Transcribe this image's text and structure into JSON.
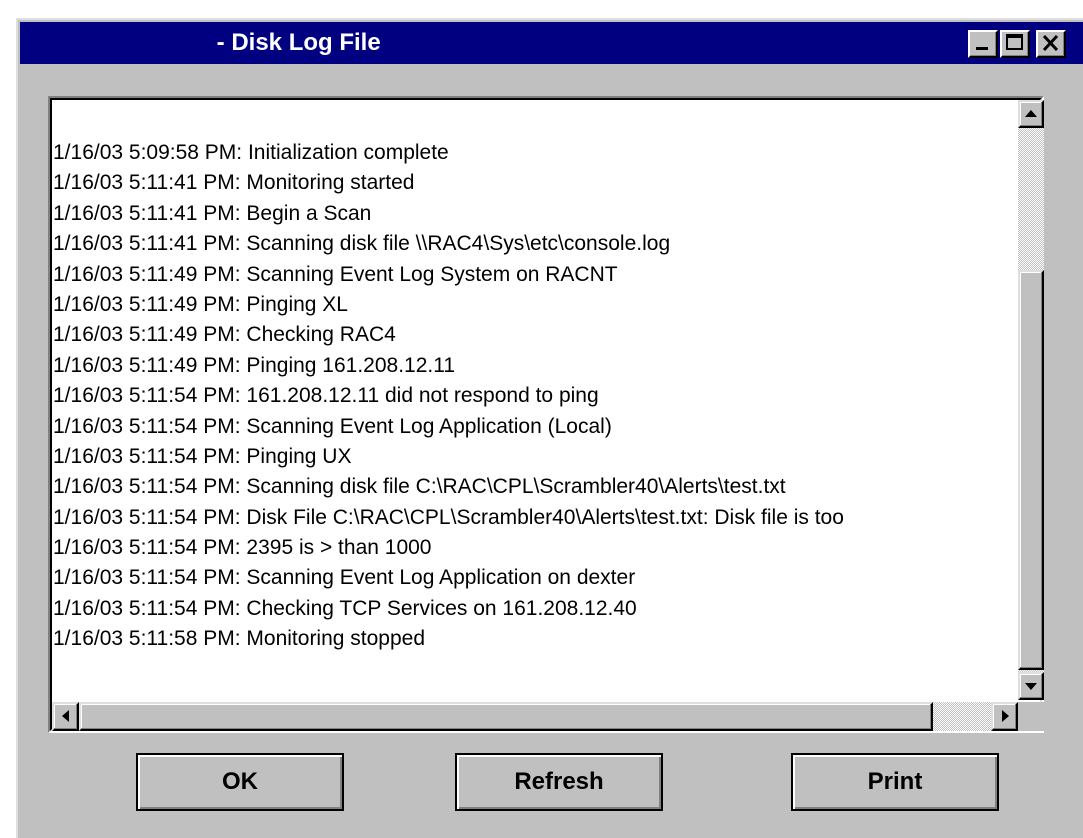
{
  "window": {
    "title": " - Disk Log File"
  },
  "log": {
    "lines": [
      "1/16/03 5:09:58 PM: Initialization complete",
      "1/16/03 5:11:41 PM: Monitoring started",
      "1/16/03 5:11:41 PM: Begin a Scan",
      "1/16/03 5:11:41 PM: Scanning disk file \\\\RAC4\\Sys\\etc\\console.log",
      "1/16/03 5:11:49 PM: Scanning Event Log System on RACNT",
      "1/16/03 5:11:49 PM: Pinging XL",
      "1/16/03 5:11:49 PM: Checking RAC4",
      "1/16/03 5:11:49 PM: Pinging 161.208.12.11",
      "1/16/03 5:11:54 PM: 161.208.12.11 did not respond to ping",
      "1/16/03 5:11:54 PM: Scanning Event Log Application (Local)",
      "1/16/03 5:11:54 PM: Pinging UX",
      "1/16/03 5:11:54 PM: Scanning disk file C:\\RAC\\CPL\\Scrambler40\\Alerts\\test.txt",
      "1/16/03 5:11:54 PM: Disk File C:\\RAC\\CPL\\Scrambler40\\Alerts\\test.txt: Disk file is too",
      "1/16/03 5:11:54 PM: 2395 is > than 1000",
      "1/16/03 5:11:54 PM: Scanning Event Log Application on dexter",
      "1/16/03 5:11:54 PM: Checking TCP Services on 161.208.12.40",
      "1/16/03 5:11:58 PM: Monitoring stopped"
    ]
  },
  "buttons": {
    "ok": "OK",
    "refresh": "Refresh",
    "print": "Print"
  },
  "colors": {
    "titlebar": "#000080",
    "face": "#c0c0c0"
  }
}
